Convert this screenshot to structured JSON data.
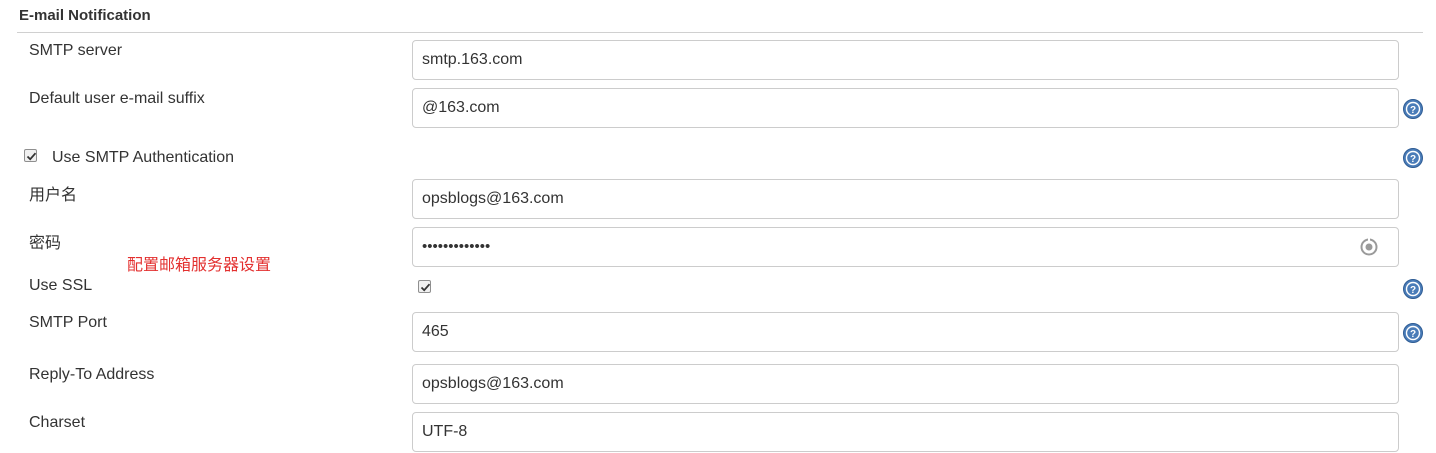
{
  "section": {
    "title": "E-mail Notification"
  },
  "fields": {
    "smtp_server": {
      "label": "SMTP server",
      "value": "smtp.163.com"
    },
    "default_suffix": {
      "label": "Default user e-mail suffix",
      "value": "@163.com"
    },
    "use_smtp_auth": {
      "label": "Use SMTP Authentication",
      "checked": true
    },
    "username": {
      "label": "用户名",
      "value": "opsblogs@163.com"
    },
    "password": {
      "label": "密码",
      "value": "•••••••••••••"
    },
    "use_ssl": {
      "label": "Use SSL",
      "checked": true
    },
    "smtp_port": {
      "label": "SMTP Port",
      "value": "465"
    },
    "reply_to": {
      "label": "Reply-To Address",
      "value": "opsblogs@163.com"
    },
    "charset": {
      "label": "Charset",
      "value": "UTF-8"
    }
  },
  "annotation": {
    "text": "配置邮箱服务器设置",
    "color": "#e3302f"
  },
  "icons": {
    "help": "help-icon",
    "reveal": "reveal-password-icon",
    "check": "checkmark-icon"
  },
  "colors": {
    "help_icon": "#3f6fa8",
    "border": "#cccccc"
  }
}
